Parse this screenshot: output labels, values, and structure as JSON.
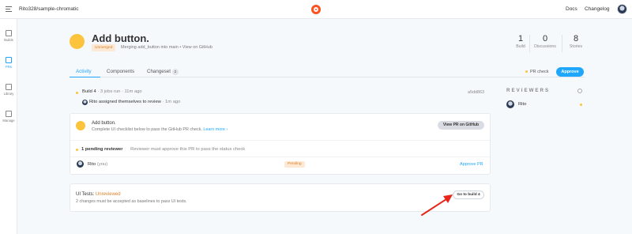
{
  "topbar": {
    "project": "Rito328/sample-chromatic",
    "docs": "Docs",
    "changelog": "Changelog"
  },
  "sidebar": {
    "items": [
      {
        "label": "Builds",
        "icon": "builds-icon"
      },
      {
        "label": "PRs",
        "icon": "pr-icon"
      },
      {
        "label": "Library",
        "icon": "library-icon"
      },
      {
        "label": "Manage",
        "icon": "manage-icon"
      }
    ]
  },
  "header": {
    "title": "Add button.",
    "badge": "Unmerged",
    "merge_text": "Merging add_button into main",
    "separator": "•",
    "github_link": "View on GitHub",
    "stats": [
      {
        "value": "1",
        "label": "Build"
      },
      {
        "value": "0",
        "label": "Discussions"
      },
      {
        "value": "8",
        "label": "Stories"
      }
    ]
  },
  "tabs": [
    {
      "label": "Activity"
    },
    {
      "label": "Components"
    },
    {
      "label": "Changeset",
      "count": "2"
    }
  ],
  "actions": {
    "pr_check": "PR check",
    "approve": "Approve"
  },
  "activity": {
    "build_label": "Build 4",
    "build_meta": "· 3 jobs run · 11m ago",
    "build_id": "a5dd863",
    "assign_text": "Rito assigned themselves to review",
    "assign_time": "· 1m ago"
  },
  "checklist_card": {
    "title": "Add button.",
    "subtitle": "Complete UI checklist below to pass the GitHub PR check.",
    "learn_more": "Learn more ›",
    "button": "View PR on GitHub",
    "pending_label": "1 pending reviewer",
    "pending_desc": "Reviewer must approve this PR to pass the status check",
    "reviewer_name": "Rito",
    "reviewer_you": "(you)",
    "reviewer_status": "Pending",
    "approve_link": "Approve PR"
  },
  "ui_tests_card": {
    "title": "UI Tests:",
    "status": "Unreviewed",
    "description": "2 changes must be accepted as baselines to pass UI tests.",
    "button": "Go to build 4"
  },
  "reviewers": {
    "title": "REVIEWERS",
    "items": [
      {
        "name": "Rito"
      }
    ]
  },
  "colors": {
    "accent": "#1ea7fd",
    "pending": "#fcc33c",
    "brand": "#fc521f",
    "arrow": "#e8261c"
  }
}
